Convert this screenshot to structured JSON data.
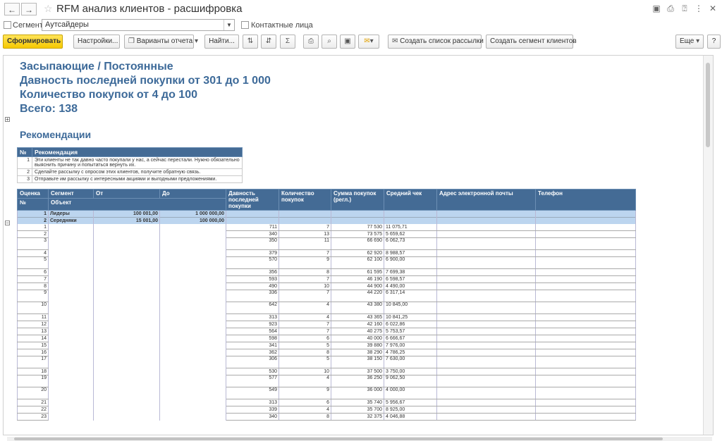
{
  "window": {
    "title": "RFM анализ клиентов - расшифровка"
  },
  "nav": {
    "back": "←",
    "forward": "→",
    "favorite": "☆"
  },
  "title_icons": {
    "save": "▣",
    "print": "⎙",
    "link": "⍰",
    "more": "⋮",
    "close": "✕"
  },
  "filters": {
    "segment_label": "Сегмент:",
    "segment_value": "Аутсайдеры",
    "contacts_label": "Контактные лица"
  },
  "toolbar": {
    "generate": "Сформировать",
    "settings": "Настройки...",
    "variants": "Варианты отчета",
    "find": "Найти...",
    "create_mailing": "Создать список рассылки",
    "create_segment": "Создать сегмент клиентов",
    "more": "Еще",
    "help": "?"
  },
  "report": {
    "heading1": "Засыпающие / Постоянные",
    "heading2": "Давность последней покупки от 301 до 1 000",
    "heading3": "Количество покупок от 4 до 100",
    "heading4": "Всего: 138",
    "recommendations_title": "Рекомендации",
    "rec_headers": [
      "№",
      "Рекомендация"
    ],
    "recommendations": [
      {
        "n": "1",
        "text": "Эти клиенты не так давно часто покупали у нас, а сейчас перестали. Нужно обязательно выяснить причину и попытаться вернуть их."
      },
      {
        "n": "2",
        "text": "Сделайте рассылку с опросом этих клиентов, получите обратную связь."
      },
      {
        "n": "3",
        "text": "Отправьте им рассылку с интересными акциями и выгодными предложениями."
      }
    ],
    "headers": {
      "rating": "Оценка",
      "segment": "Сегмент",
      "from": "От",
      "to": "До",
      "recency": "Давность последней покупки",
      "count": "Количество покупок",
      "sum": "Сумма покупок (регл.)",
      "avg": "Средний чек",
      "email": "Адрес электронной почты",
      "phone": "Телефон",
      "num": "№",
      "object": "Объект"
    },
    "segments": [
      {
        "n": "1",
        "name": "Лидеры",
        "from": "100 001,00",
        "to": "1 000 000,00"
      },
      {
        "n": "2",
        "name": "Середняки",
        "from": "15 001,00",
        "to": "100 000,00"
      }
    ],
    "rows": [
      {
        "n": "1",
        "recency": "711",
        "count": "7",
        "sum": "77 530",
        "avg": "11 075,71",
        "pad": false
      },
      {
        "n": "2",
        "recency": "340",
        "count": "13",
        "sum": "73 575",
        "avg": "5 659,62",
        "pad": false
      },
      {
        "n": "3",
        "recency": "350",
        "count": "11",
        "sum": "66 690",
        "avg": "6 062,73",
        "pad": true
      },
      {
        "n": "4",
        "recency": "379",
        "count": "7",
        "sum": "62 920",
        "avg": "8 988,57",
        "pad": false
      },
      {
        "n": "5",
        "recency": "570",
        "count": "9",
        "sum": "62 100",
        "avg": "6 900,00",
        "pad": true
      },
      {
        "n": "6",
        "recency": "356",
        "count": "8",
        "sum": "61 595",
        "avg": "7 699,38",
        "pad": false
      },
      {
        "n": "7",
        "recency": "593",
        "count": "7",
        "sum": "46 190",
        "avg": "6 598,57",
        "pad": false
      },
      {
        "n": "8",
        "recency": "490",
        "count": "10",
        "sum": "44 900",
        "avg": "4 490,00",
        "pad": false
      },
      {
        "n": "9",
        "recency": "336",
        "count": "7",
        "sum": "44 220",
        "avg": "6 317,14",
        "pad": true
      },
      {
        "n": "10",
        "recency": "642",
        "count": "4",
        "sum": "43 380",
        "avg": "10 845,00",
        "pad": true
      },
      {
        "n": "11",
        "recency": "313",
        "count": "4",
        "sum": "43 365",
        "avg": "10 841,25",
        "pad": false
      },
      {
        "n": "12",
        "recency": "923",
        "count": "7",
        "sum": "42 160",
        "avg": "6 022,86",
        "pad": false
      },
      {
        "n": "13",
        "recency": "564",
        "count": "7",
        "sum": "40 275",
        "avg": "5 753,57",
        "pad": false
      },
      {
        "n": "14",
        "recency": "598",
        "count": "6",
        "sum": "40 000",
        "avg": "6 666,67",
        "pad": false
      },
      {
        "n": "15",
        "recency": "341",
        "count": "5",
        "sum": "39 880",
        "avg": "7 976,00",
        "pad": false
      },
      {
        "n": "16",
        "recency": "362",
        "count": "8",
        "sum": "38 290",
        "avg": "4 786,25",
        "pad": false
      },
      {
        "n": "17",
        "recency": "306",
        "count": "5",
        "sum": "38 150",
        "avg": "7 630,00",
        "pad": true
      },
      {
        "n": "18",
        "recency": "530",
        "count": "10",
        "sum": "37 500",
        "avg": "3 750,00",
        "pad": false
      },
      {
        "n": "19",
        "recency": "577",
        "count": "4",
        "sum": "36 250",
        "avg": "9 062,50",
        "pad": true
      },
      {
        "n": "20",
        "recency": "549",
        "count": "9",
        "sum": "36 000",
        "avg": "4 000,00",
        "pad": true
      },
      {
        "n": "21",
        "recency": "313",
        "count": "6",
        "sum": "35 740",
        "avg": "5 956,67",
        "pad": false
      },
      {
        "n": "22",
        "recency": "339",
        "count": "4",
        "sum": "35 700",
        "avg": "8 925,00",
        "pad": false
      },
      {
        "n": "23",
        "recency": "340",
        "count": "8",
        "sum": "32 375",
        "avg": "4 046,88",
        "pad": false
      }
    ]
  }
}
